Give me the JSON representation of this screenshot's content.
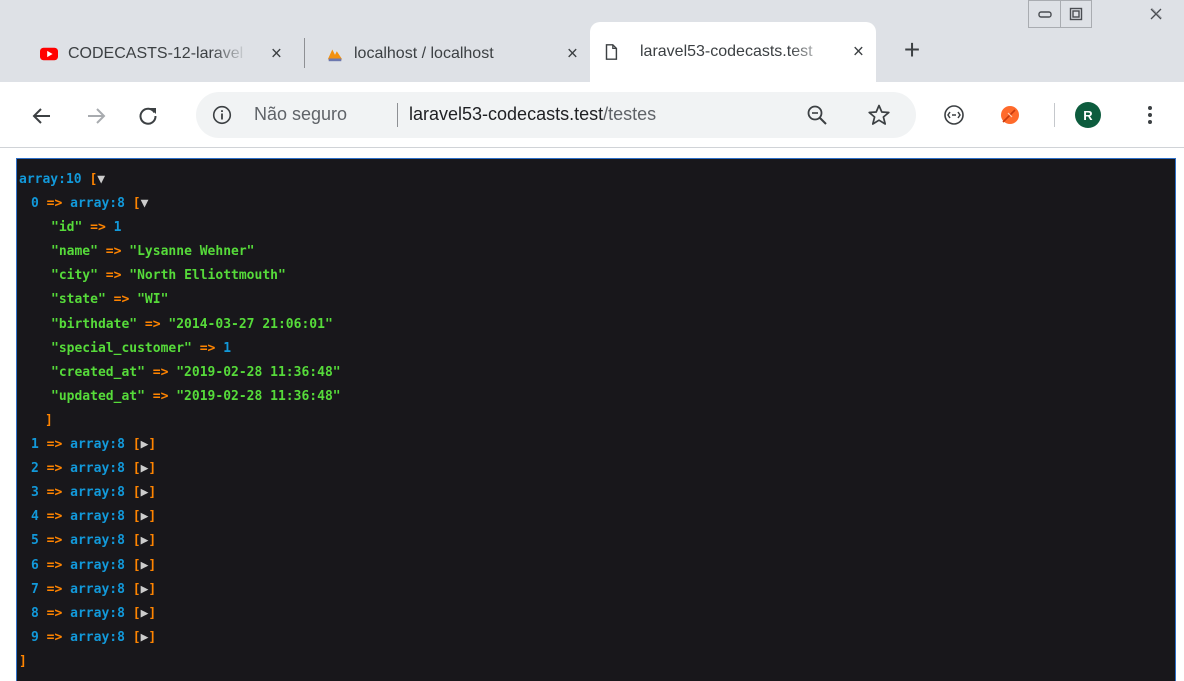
{
  "tabs": [
    {
      "title": "CODECASTS-12-laravel",
      "favicon": "youtube-icon",
      "active": false
    },
    {
      "title": "localhost / localhost",
      "favicon": "phpmyadmin-icon",
      "active": false
    },
    {
      "title": "laravel53-codecasts.test",
      "favicon": "page-icon",
      "active": true
    }
  ],
  "tab_close": "×",
  "new_tab": "+",
  "toolbar": {
    "security_label": "Não seguro",
    "url_host": "laravel53-codecasts.test",
    "url_path": "/testes",
    "avatar_letter": "R"
  },
  "dump": {
    "root_label": "array:10",
    "open_bracket": "[",
    "close_bracket": "]",
    "expanded_symbol": "▼",
    "collapsed_symbol": "▶",
    "arrow": "=>",
    "expanded_item": {
      "index": "0",
      "type": "array:8",
      "fields": [
        {
          "key": "\"id\"",
          "value": "1",
          "kind": "num"
        },
        {
          "key": "\"name\"",
          "value": "\"Lysanne Wehner\"",
          "kind": "str"
        },
        {
          "key": "\"city\"",
          "value": "\"North Elliottmouth\"",
          "kind": "str"
        },
        {
          "key": "\"state\"",
          "value": "\"WI\"",
          "kind": "str"
        },
        {
          "key": "\"birthdate\"",
          "value": "\"2014-03-27 21:06:01\"",
          "kind": "str"
        },
        {
          "key": "\"special_customer\"",
          "value": "1",
          "kind": "num"
        },
        {
          "key": "\"created_at\"",
          "value": "\"2019-02-28 11:36:48\"",
          "kind": "str"
        },
        {
          "key": "\"updated_at\"",
          "value": "\"2019-02-28 11:36:48\"",
          "kind": "str"
        }
      ]
    },
    "collapsed_items": [
      {
        "index": "1",
        "type": "array:8"
      },
      {
        "index": "2",
        "type": "array:8"
      },
      {
        "index": "3",
        "type": "array:8"
      },
      {
        "index": "4",
        "type": "array:8"
      },
      {
        "index": "5",
        "type": "array:8"
      },
      {
        "index": "6",
        "type": "array:8"
      },
      {
        "index": "7",
        "type": "array:8"
      },
      {
        "index": "8",
        "type": "array:8"
      },
      {
        "index": "9",
        "type": "array:8"
      }
    ]
  },
  "colors": {
    "dump_background": "#18171b",
    "type": "#1299da",
    "bracket": "#ff8400",
    "key": "#56db3a",
    "string": "#56db3a",
    "number": "#1299da",
    "avatar": "#0d5c3e"
  }
}
